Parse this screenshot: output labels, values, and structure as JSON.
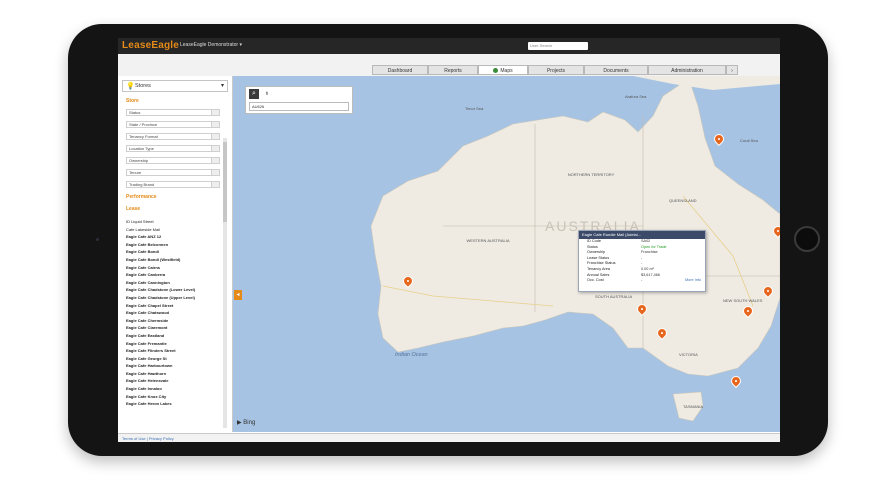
{
  "app": {
    "logo": "LeaseEagle",
    "org_selector": "LeaseEagle Demonstrator ▾",
    "search_placeholder": "User Search"
  },
  "tabs": [
    {
      "label": "Dashboard"
    },
    {
      "label": "Reports"
    },
    {
      "label": "Maps"
    },
    {
      "label": "Projects"
    },
    {
      "label": "Documents"
    },
    {
      "label": "Administration"
    },
    {
      "label": "›"
    }
  ],
  "left_panel": {
    "selector": "Stores",
    "section_store": "Store",
    "fields": [
      "Status",
      "State / Province",
      "Tenancy Format",
      "Location Type",
      "Ownership",
      "Tenure",
      "Trading Brand"
    ],
    "section_performance": "Performance",
    "section_lease": "Lease",
    "stores": [
      "ID Liquid Street",
      "Cafe Lakeside Mall",
      "Eagle Cafe ANZ 12",
      "Eagle Cafe Belconnen",
      "Eagle Cafe Bondi",
      "Eagle Cafe Bondi (Westfield)",
      "Eagle Cafe Cairns",
      "Eagle Cafe Canberra",
      "Eagle Cafe Cannington",
      "Eagle Cafe Chadstone (Lower Level)",
      "Eagle Cafe Chadstone (Upper Level)",
      "Eagle Cafe Chapel Street",
      "Eagle Cafe Chatswood",
      "Eagle Cafe Chermside",
      "Eagle Cafe Claremont",
      "Eagle Cafe Eastland",
      "Eagle Cafe Fremantle",
      "Eagle Cafe Flinders Street",
      "Eagle Cafe George St",
      "Eagle Cafe Harbourtown",
      "Eagle Cafe Hawthorn",
      "Eagle Cafe Helensvale",
      "Eagle Cafe Innaloo",
      "Eagle Cafe Knox City",
      "Eagle Cafe Heron Lakes"
    ]
  },
  "footer": "Terms of Use | Privacy Policy",
  "map": {
    "search_value": "AU626",
    "country_label": "AUSTRALIA",
    "ocean_label": "Indian Ocean",
    "region_labels": [
      "Timor Sea",
      "Arafura Sea",
      "Coral Sea",
      "NORTHERN TERRITORY",
      "QUEENSLAND",
      "WESTERN AUSTRALIA",
      "SOUTH AUSTRALIA",
      "NEW SOUTH WALES",
      "VICTORIA",
      "TASMANIA"
    ],
    "attribution": "Bing",
    "popup": {
      "title": "Eagle Cafe Rundle Mall (Adelai...",
      "rows": [
        {
          "k": "ID Code",
          "v": "SA02"
        },
        {
          "k": "Status",
          "v": "Open for Trade"
        },
        {
          "k": "Ownership",
          "v": "Franchise"
        },
        {
          "k": "Lease Status",
          "v": "-"
        },
        {
          "k": "Franchise Status",
          "v": "-"
        },
        {
          "k": "Tenancy Area",
          "v": "0.00 m²"
        },
        {
          "k": "Annual Sales",
          "v": "$3,617,466"
        },
        {
          "k": "Occ. Cost",
          "v": "-"
        }
      ],
      "more_link": "More Info"
    }
  },
  "colors": {
    "accent": "#e58a18",
    "pin": "#e8671e",
    "water": "#a6c3e3",
    "land": "#efebe3"
  }
}
